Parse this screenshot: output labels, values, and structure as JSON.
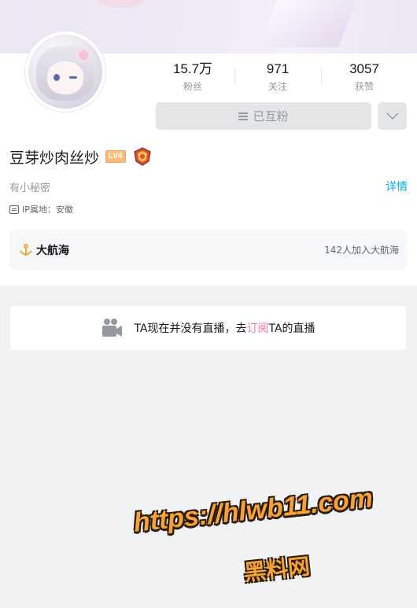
{
  "profile": {
    "name": "豆芽炒肉丝炒",
    "level_badge": "LV4",
    "signature": "有小秘密",
    "detail_link": "详情",
    "ip_location": "IP属地：安徽"
  },
  "stats": [
    {
      "value": "15.7万",
      "label": "粉丝"
    },
    {
      "value": "971",
      "label": "关注"
    },
    {
      "value": "3057",
      "label": "获赞"
    }
  ],
  "actions": {
    "follow_label": "已互粉"
  },
  "guard": {
    "title": "大航海",
    "count_text": "142人加入大航海"
  },
  "live": {
    "text_before": "TA现在并没有直播，去",
    "link_text": "订阅",
    "text_after": "TA的直播"
  },
  "watermark": {
    "url": "https://hlwb11.com",
    "site_name": "黑料网"
  },
  "colors": {
    "accent_blue": "#00aeec",
    "accent_pink": "#fb7299",
    "level_orange": "#fbbd78"
  }
}
